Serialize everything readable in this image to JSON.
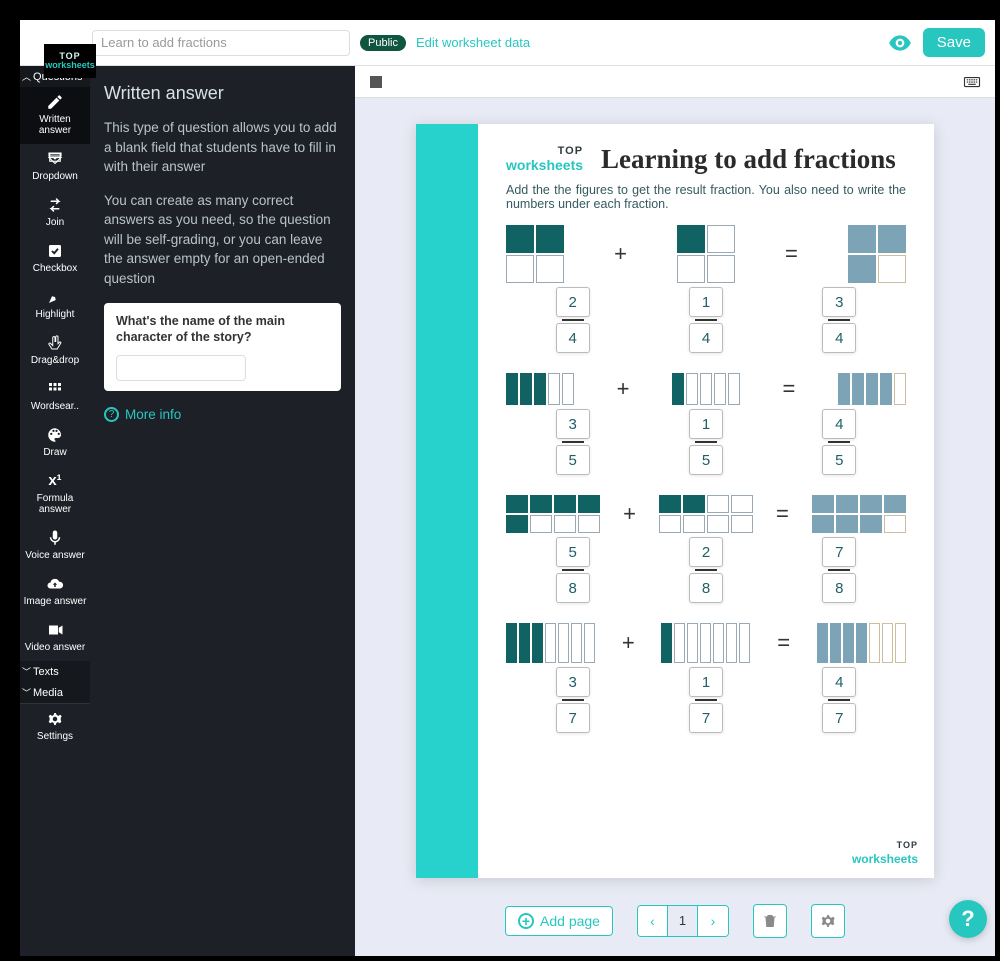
{
  "brand": {
    "top": "TOP",
    "bottom": "worksheets"
  },
  "header": {
    "title_input": "Learn to add fractions",
    "public_badge": "Public",
    "edit_link": "Edit worksheet data",
    "save": "Save"
  },
  "sidebar": {
    "sections": {
      "questions": "Questions",
      "texts": "Texts",
      "media": "Media"
    },
    "items": [
      {
        "label": "Written answer"
      },
      {
        "label": "Dropdown"
      },
      {
        "label": "Join"
      },
      {
        "label": "Checkbox"
      },
      {
        "label": "Highlight"
      },
      {
        "label": "Drag&drop"
      },
      {
        "label": "Wordsear.."
      },
      {
        "label": "Draw"
      },
      {
        "label": "Formula answer"
      },
      {
        "label": "Voice answer"
      },
      {
        "label": "Image answer"
      },
      {
        "label": "Video answer"
      }
    ],
    "settings": "Settings"
  },
  "explain": {
    "title": "Written answer",
    "p1": "This type of question allows you to add a blank field that students have to fill in with their answer",
    "p2": "You can create as many correct answers as you need, so the question will be self-grading, or you can leave the answer empty for an open-ended question",
    "example_q": "What's the name of the main character of the story?",
    "more_info": "More info"
  },
  "page": {
    "title": "Learning to add fractions",
    "instructions": "Add the the figures to get the result fraction. You also need to write the numbers under each fraction.",
    "rows": [
      {
        "a": {
          "n": 2,
          "d": 4
        },
        "b": {
          "n": 1,
          "d": 4
        },
        "r": {
          "n": 3,
          "d": 4
        }
      },
      {
        "a": {
          "n": 3,
          "d": 5
        },
        "b": {
          "n": 1,
          "d": 5
        },
        "r": {
          "n": 4,
          "d": 5
        }
      },
      {
        "a": {
          "n": 5,
          "d": 8
        },
        "b": {
          "n": 2,
          "d": 8
        },
        "r": {
          "n": 7,
          "d": 8
        }
      },
      {
        "a": {
          "n": 3,
          "d": 7
        },
        "b": {
          "n": 1,
          "d": 7
        },
        "r": {
          "n": 4,
          "d": 7
        }
      }
    ]
  },
  "controls": {
    "add_page": "Add page",
    "page_number": "1"
  }
}
